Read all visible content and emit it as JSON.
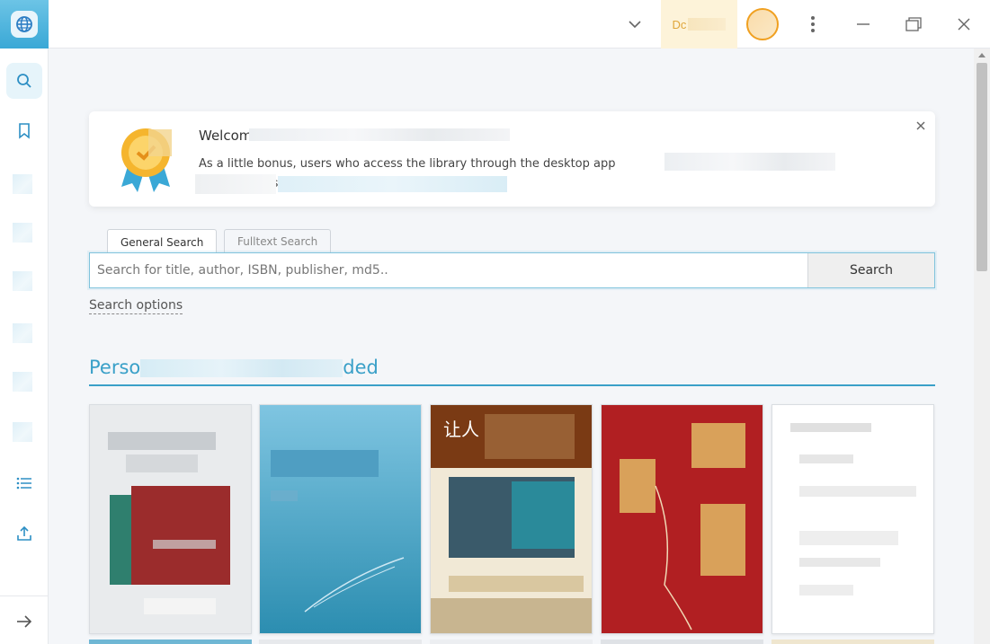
{
  "titlebar": {
    "account_label": "Dc",
    "icons": [
      "globe-icon",
      "chevron-down-icon",
      "more-vertical-icon",
      "minimize-icon",
      "maximize-icon",
      "close-icon"
    ]
  },
  "sidebar": {
    "icons": [
      "search-icon",
      "bookmark-icon",
      "list-icon",
      "upload-icon",
      "arrow-right-icon"
    ]
  },
  "welcome": {
    "title": "Welcome",
    "text": "As a little bonus, users who access the library through the desktop app",
    "text_tail": "remium",
    "text_line2": "bership"
  },
  "search": {
    "tabs": [
      "General Search",
      "Fulltext Search"
    ],
    "placeholder": "Search for title, author, ISBN, publisher, md5..",
    "button_label": "Search",
    "options_label": "Search options"
  },
  "section": {
    "title_prefix": "Perso",
    "title_suffix": "ded"
  },
  "books": [
    {
      "cover_top_text": "",
      "colors": [
        "#e9ebed",
        "#9b2c2c"
      ]
    },
    {
      "cover_top_text": "",
      "colors": [
        "#7fc5e1",
        "#2b8db0"
      ]
    },
    {
      "cover_top_text": "让人",
      "colors": [
        "#7a3a14",
        "#f1e9d6"
      ]
    },
    {
      "cover_top_text": "",
      "colors": [
        "#b11f22",
        "#d9a15a"
      ]
    },
    {
      "cover_top_text": "",
      "colors": [
        "#ffffff",
        "#e6e6e6"
      ]
    }
  ],
  "colors": {
    "accent": "#3aa0c8",
    "account_bg": "#fdf3d9",
    "avatar_ring": "#f0a020"
  }
}
